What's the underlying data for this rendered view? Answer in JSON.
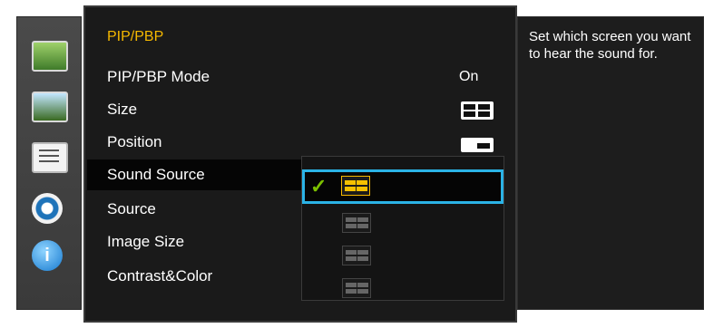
{
  "menu": {
    "title": "PIP/PBP",
    "items": [
      {
        "label": "PIP/PBP Mode",
        "value": "On"
      },
      {
        "label": "Size"
      },
      {
        "label": "Position"
      },
      {
        "label": "Sound Source"
      },
      {
        "label": "Source"
      },
      {
        "label": "Image Size"
      },
      {
        "label": "Contrast&Color"
      }
    ],
    "selected_index": 3
  },
  "help": {
    "text": "Set which screen you want to hear the sound for."
  },
  "sound_source_popup": {
    "options": [
      "left-screen",
      "right-screen",
      "top-screen",
      "bottom-screen"
    ],
    "selected_option": 0
  },
  "sidebar_icons": [
    "picture-icon",
    "screen-adjust-icon",
    "system-sliders-icon",
    "settings-gear-icon",
    "info-icon"
  ],
  "colors": {
    "title": "#f5b800",
    "selection_border": "#2bb3e6",
    "check": "#7cc000"
  }
}
